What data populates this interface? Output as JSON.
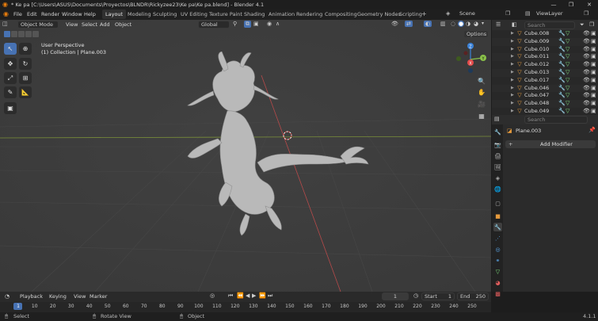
{
  "window": {
    "title": "* Ke pa [C:\\Users\\ASUS\\Documents\\Proyectos\\BLNDR\\Rickyzee23\\Ke pa\\Ke pa.blend] - Blender 4.1"
  },
  "menu": [
    "File",
    "Edit",
    "Render",
    "Window",
    "Help"
  ],
  "workspaces": [
    "Layout",
    "Modeling",
    "Sculpting",
    "UV Editing",
    "Texture Paint",
    "Shading",
    "Animation",
    "Rendering",
    "Compositing",
    "Geometry Nodes",
    "Scripting"
  ],
  "scene_field": "Scene",
  "viewlayer_field": "ViewLayer",
  "viewport": {
    "mode": "Object Mode",
    "menus": [
      "View",
      "Select",
      "Add",
      "Object"
    ],
    "orientation": "Global",
    "options_label": "Options",
    "perspective_label": "User Perspective",
    "collection_label": "(1) Collection | Plane.003",
    "gizmo_x": "X",
    "gizmo_y": "Y",
    "gizmo_z": "Z"
  },
  "outliner": {
    "search_placeholder": "Search",
    "items": [
      "Cube.008",
      "Cube.009",
      "Cube.010",
      "Cube.011",
      "Cube.012",
      "Cube.013",
      "Cube.017",
      "Cube.046",
      "Cube.047",
      "Cube.048",
      "Cube.049"
    ]
  },
  "properties": {
    "search_placeholder": "Search",
    "object_name": "Plane.003",
    "add_modifier_label": "Add Modifier"
  },
  "timeline": {
    "menus": [
      "Playback",
      "Keying",
      "View",
      "Marker"
    ],
    "current_frame": "1",
    "start_label": "Start",
    "start_value": "1",
    "end_label": "End",
    "end_value": "250",
    "ticks": [
      "1",
      "10",
      "20",
      "30",
      "40",
      "50",
      "60",
      "70",
      "80",
      "90",
      "100",
      "110",
      "120",
      "130",
      "140",
      "150",
      "160",
      "170",
      "180",
      "190",
      "200",
      "210",
      "220",
      "230",
      "240",
      "250"
    ]
  },
  "statusbar": {
    "select": "Select",
    "rotate": "Rotate View",
    "object": "Object",
    "version": "4.1.1"
  },
  "colors": {
    "accent": "#4772b3",
    "axis_x": "#e34a4a",
    "axis_y": "#8bc34a",
    "axis_z": "#3b82d8",
    "object_orange": "#e59a3c"
  }
}
